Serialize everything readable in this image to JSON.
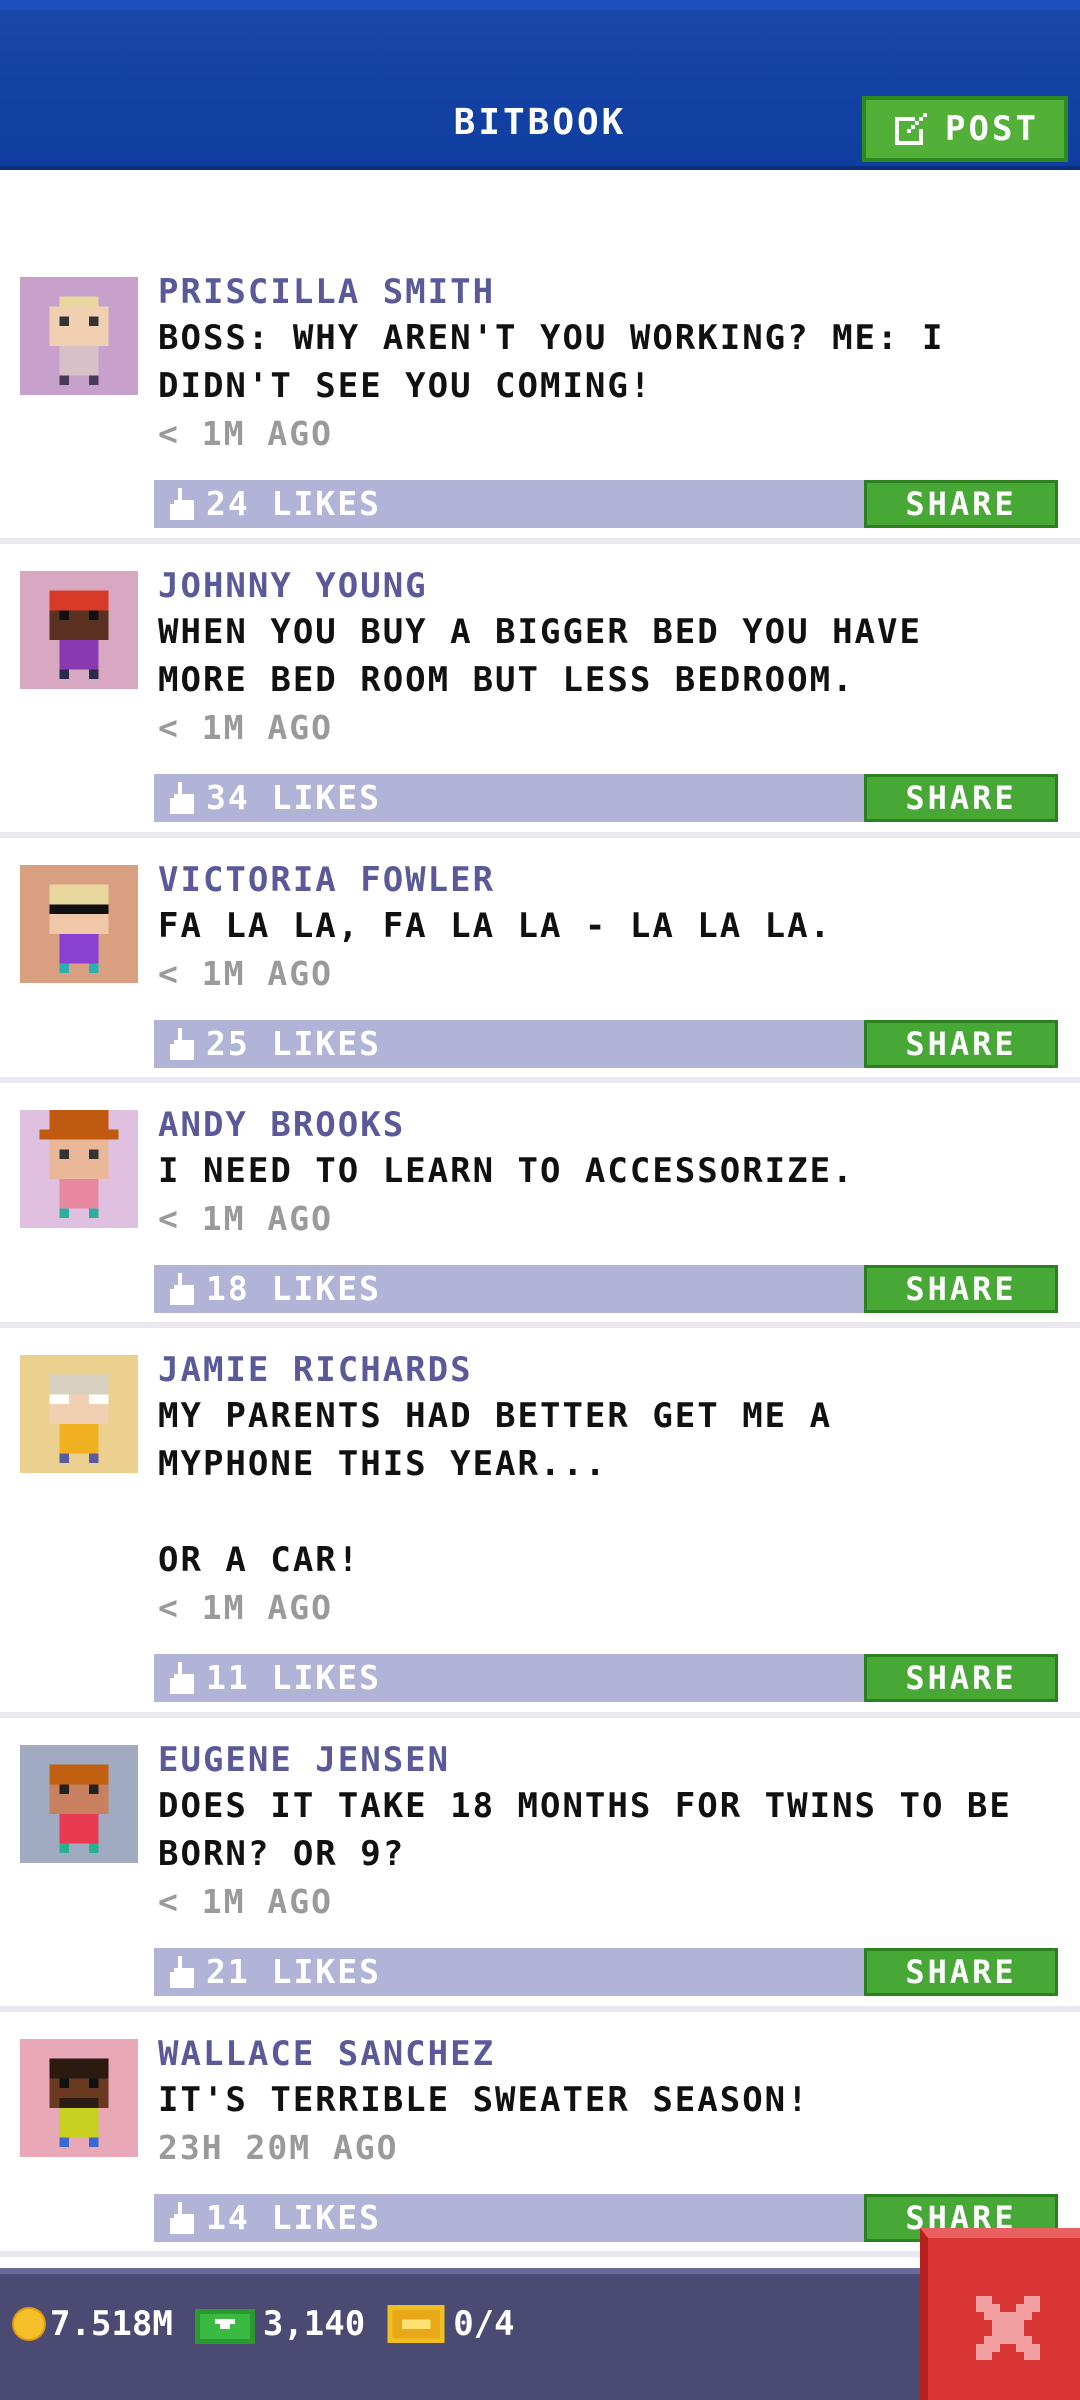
{
  "header": {
    "title": "BITBOOK",
    "post_label": "POST"
  },
  "posts": [
    {
      "name": "PRISCILLA SMITH",
      "text": "BOSS: WHY AREN'T YOU WORKING? ME: I\nDIDN'T SEE YOU COMING!",
      "time": "< 1M AGO",
      "likes": "24 LIKES",
      "share": "SHARE",
      "avatar_bg": "#c8a0cc"
    },
    {
      "name": "JOHNNY YOUNG",
      "text": "WHEN YOU BUY A BIGGER BED YOU HAVE\nMORE BED ROOM BUT LESS BEDROOM.",
      "time": "< 1M AGO",
      "likes": "34 LIKES",
      "share": "SHARE",
      "avatar_bg": "#d8a8c0"
    },
    {
      "name": "VICTORIA FOWLER",
      "text": "FA LA LA, FA LA LA - LA LA LA.",
      "time": "< 1M AGO",
      "likes": "25 LIKES",
      "share": "SHARE",
      "avatar_bg": "#d8a080"
    },
    {
      "name": "ANDY BROOKS",
      "text": "I NEED TO LEARN TO ACCESSORIZE.",
      "time": "< 1M AGO",
      "likes": "18 LIKES",
      "share": "SHARE",
      "avatar_bg": "#e0c0e0"
    },
    {
      "name": "JAMIE RICHARDS",
      "text": "MY PARENTS HAD BETTER GET ME A\nMYPHONE THIS YEAR...\n\nOR A CAR!",
      "time": "< 1M AGO",
      "likes": "11 LIKES",
      "share": "SHARE",
      "avatar_bg": "#ecd090"
    },
    {
      "name": "EUGENE JENSEN",
      "text": "DOES IT TAKE 18 MONTHS FOR TWINS TO BE\nBORN? OR 9?",
      "time": "< 1M AGO",
      "likes": "21 LIKES",
      "share": "SHARE",
      "avatar_bg": "#a0aac0"
    },
    {
      "name": "WALLACE SANCHEZ",
      "text": "IT'S TERRIBLE SWEATER SEASON!",
      "time": "23H 20M AGO",
      "likes": "14 LIKES",
      "share": "SHARE",
      "avatar_bg": "#e8a8b8"
    }
  ],
  "status": {
    "coins": "7.518M",
    "bux": "3,140",
    "tickets": "0/4"
  },
  "colors": {
    "header": "#0d3ea0",
    "share": "#48a836",
    "likebar": "#b1b4d6",
    "close": "#d83434"
  }
}
